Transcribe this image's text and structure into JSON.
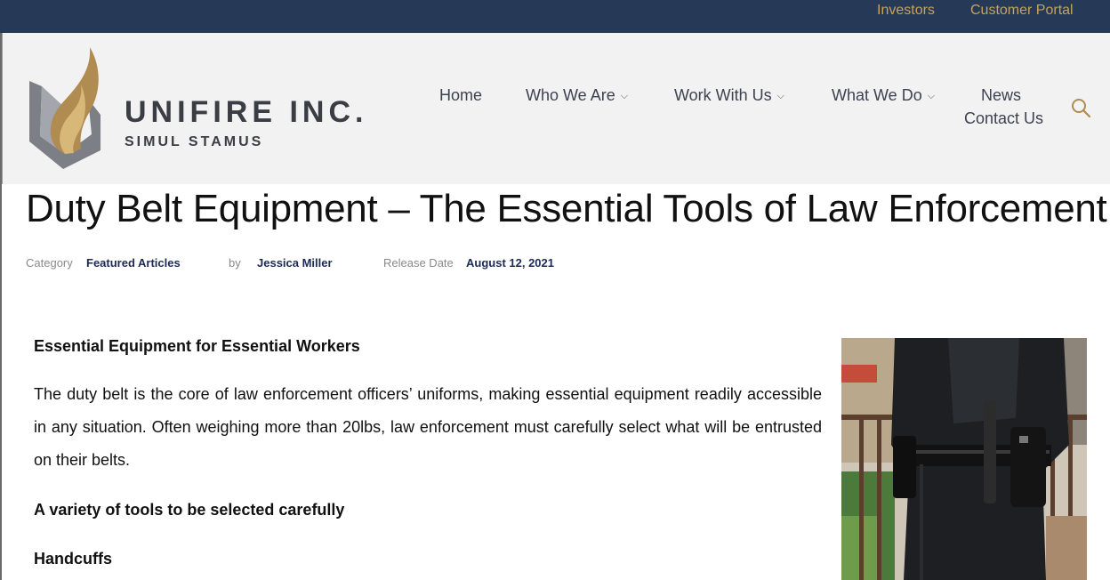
{
  "topbar": {
    "investors": "Investors",
    "customer_portal": "Customer Portal"
  },
  "brand": {
    "name": "UNIFIRE INC.",
    "tagline": "SIMUL STAMUS"
  },
  "nav": {
    "home": "Home",
    "who_we_are": "Who We Are",
    "work_with_us": "Work With Us",
    "what_we_do": "What We Do",
    "news": "News",
    "contact_us": "Contact Us"
  },
  "article": {
    "title": "Duty Belt Equipment – The Essential Tools of Law Enforcement",
    "meta": {
      "category_label": "Category",
      "category_value": "Featured Articles",
      "by_label": "by",
      "author": "Jessica Miller",
      "release_label": "Release Date",
      "release_date": "August 12, 2021"
    },
    "heading1": "Essential Equipment for Essential Workers",
    "paragraph1": "The duty belt is the core of law enforcement officers’ uniforms, making essential equipment readily accessible in any situation. Often weighing more than 20lbs, law enforcement must carefully select what will be entrusted on their belts.",
    "heading2": "A variety of tools to be selected carefully",
    "heading3": "Handcuffs"
  },
  "colors": {
    "topbar": "#263956",
    "gold": "#c6a35d",
    "meta_value": "#1c2a55"
  }
}
